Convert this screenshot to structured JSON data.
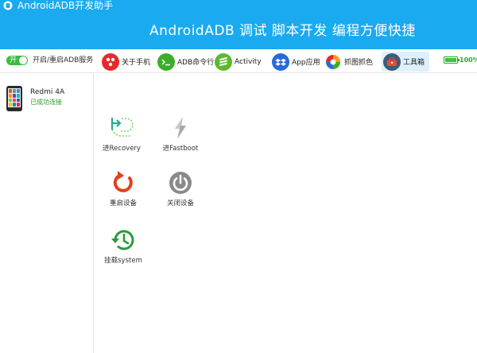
{
  "window": {
    "title": "AndroidADB开发助手",
    "slogan": "AndroidADB 调试  脚本开发  编程方便快捷"
  },
  "service": {
    "toggle_text": "开",
    "label": "开启/重启ADB服务",
    "on": true
  },
  "toolbar": {
    "items": [
      {
        "label": "关于手机",
        "icon": "dots-icon",
        "color": "#e62a2a"
      },
      {
        "label": "ADB命令行",
        "icon": "terminal-icon",
        "color": "#3aae2a"
      },
      {
        "label": "Activity",
        "icon": "layers-icon",
        "color": "#5cb82c"
      },
      {
        "label": "App应用",
        "icon": "dropbox-icon",
        "color": "#2a6ad8"
      },
      {
        "label": "抓图抓色",
        "icon": "color-wheel-icon",
        "color": "#f0a020"
      },
      {
        "label": "工具箱",
        "icon": "toolbox-icon",
        "color": "#d83a3a"
      }
    ],
    "active_index": 5
  },
  "battery": {
    "percent_text": "100%",
    "level": 1.0
  },
  "device": {
    "name": "Redmi 4A",
    "status": "已成功连接"
  },
  "actions": [
    {
      "label": "进Recovery",
      "icon": "recovery-icon",
      "color": "#2aaa8a"
    },
    {
      "label": "进Fastboot",
      "icon": "lightning-icon",
      "color": "#9a9a9a"
    },
    {
      "label": "重启设备",
      "icon": "restart-icon",
      "color": "#e0401a"
    },
    {
      "label": "关闭设备",
      "icon": "power-icon",
      "color": "#8a8a8a"
    },
    {
      "label": "挂载system",
      "icon": "history-icon",
      "color": "#2a9a3a"
    }
  ]
}
